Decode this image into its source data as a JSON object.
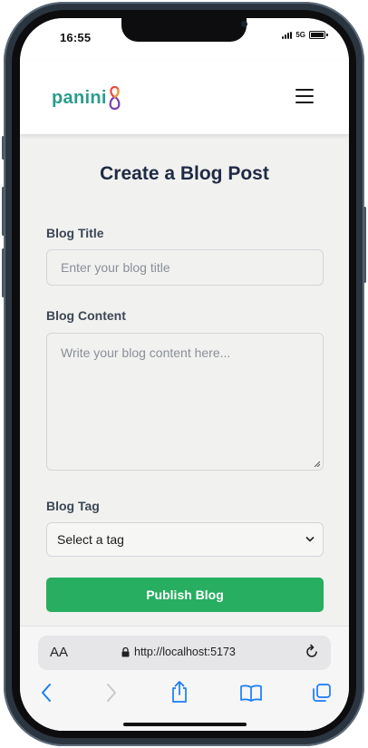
{
  "status_bar": {
    "time": "16:55",
    "network": "5G"
  },
  "header": {
    "logo_text": "panini",
    "menu_icon": "hamburger-menu-icon"
  },
  "form": {
    "heading": "Create a Blog Post",
    "title_label": "Blog Title",
    "title_placeholder": "Enter your blog title",
    "content_label": "Blog Content",
    "content_placeholder": "Write your blog content here...",
    "tag_label": "Blog Tag",
    "tag_selected": "Select a tag",
    "submit_label": "Publish Blog"
  },
  "browser": {
    "text_size_label": "AA",
    "url": "http://localhost:5173",
    "toolbar_icons": [
      "back-icon",
      "forward-icon",
      "share-icon",
      "bookmarks-icon",
      "tabs-icon"
    ]
  },
  "colors": {
    "accent_green": "#27ae60",
    "heading": "#1f2a44",
    "logo_teal": "#2a9c8c",
    "ios_blue": "#1a7cf5"
  }
}
